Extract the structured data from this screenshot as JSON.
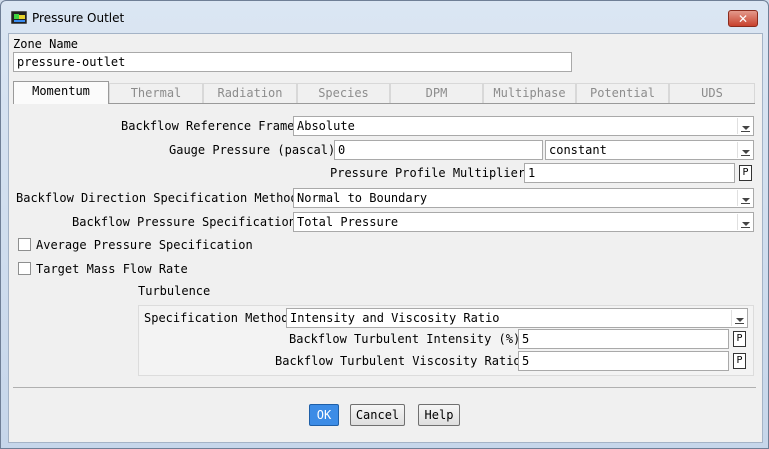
{
  "window": {
    "title": "Pressure Outlet",
    "close_label": "✕"
  },
  "zone": {
    "label": "Zone Name",
    "value": "pressure-outlet"
  },
  "tabs": [
    {
      "label": "Momentum",
      "active": true
    },
    {
      "label": "Thermal",
      "active": false
    },
    {
      "label": "Radiation",
      "active": false
    },
    {
      "label": "Species",
      "active": false
    },
    {
      "label": "DPM",
      "active": false
    },
    {
      "label": "Multiphase",
      "active": false
    },
    {
      "label": "Potential",
      "active": false
    },
    {
      "label": "UDS",
      "active": false
    }
  ],
  "momentum": {
    "backflow_ref_frame": {
      "label": "Backflow Reference Frame",
      "value": "Absolute"
    },
    "gauge_pressure": {
      "label": "Gauge Pressure (pascal)",
      "value": "0",
      "method": "constant"
    },
    "profile_multiplier": {
      "label": "Pressure Profile Multiplier",
      "value": "1",
      "p_label": "P"
    },
    "backflow_direction": {
      "label": "Backflow Direction Specification Method",
      "value": "Normal to Boundary"
    },
    "backflow_pressure": {
      "label": "Backflow Pressure Specification",
      "value": "Total Pressure"
    },
    "average_pressure": {
      "label": "Average Pressure Specification",
      "checked": false
    },
    "target_mass_flow": {
      "label": "Target Mass Flow Rate",
      "checked": false
    }
  },
  "turbulence": {
    "heading": "Turbulence",
    "spec_method": {
      "label": "Specification Method",
      "value": "Intensity and Viscosity Ratio"
    },
    "intensity": {
      "label": "Backflow Turbulent Intensity (%)",
      "value": "5",
      "p_label": "P"
    },
    "viscosity_ratio": {
      "label": "Backflow Turbulent Viscosity Ratio",
      "value": "5",
      "p_label": "P"
    }
  },
  "buttons": {
    "ok": "OK",
    "cancel": "Cancel",
    "help": "Help"
  }
}
